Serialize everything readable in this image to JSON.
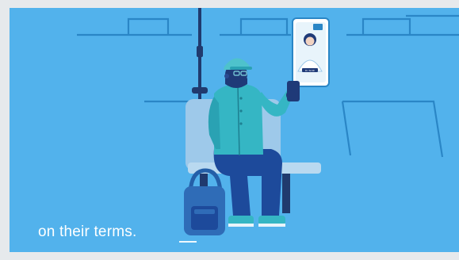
{
  "caption": {
    "text": "on their terms."
  },
  "phone_screen": {
    "badge_text": "Dr. Smith"
  },
  "colors": {
    "background": "#52b2ec",
    "line": "#2a86c6",
    "seat": "#9ec9ea",
    "jacket": "#35b6c4",
    "skin": "#1f3a78",
    "pants": "#1d4a9b",
    "cap": "#4ec2cc",
    "backpack": "#245fa8",
    "caption_text": "#ffffff"
  },
  "icons": {
    "video_call": "video-call-window",
    "backpack": "backpack-icon"
  }
}
